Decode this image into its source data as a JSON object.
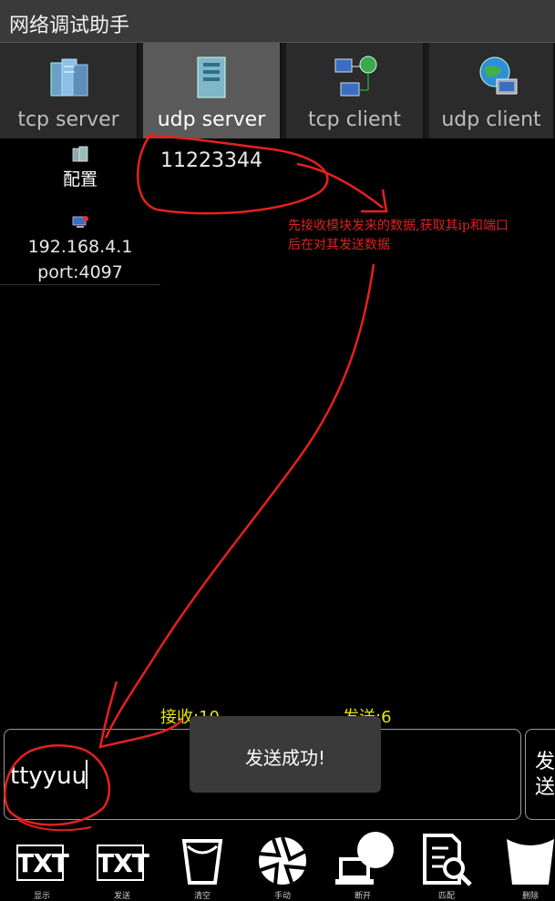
{
  "app": {
    "title": "网络调试助手"
  },
  "tabs": [
    {
      "label": "tcp server",
      "icon": "server-icon",
      "active": false
    },
    {
      "label": "udp server",
      "icon": "server-tower-icon",
      "active": true
    },
    {
      "label": "tcp client",
      "icon": "network-globe-icon",
      "active": false
    },
    {
      "label": "udp client",
      "icon": "globe-computer-icon",
      "active": false
    }
  ],
  "left_panel": {
    "config_label": "配置",
    "device_ip": "192.168.4.1",
    "device_port": "port:4097"
  },
  "received": {
    "text": "11223344"
  },
  "annotation": {
    "line1": "先接收模块发来的数据,获取其ip和端口",
    "line2": "后在对其发送数据"
  },
  "counters": {
    "recv": "接收:10",
    "send": "发送:6"
  },
  "input": {
    "value": "ttyyuu"
  },
  "send_button": {
    "label": "发送"
  },
  "toast": {
    "text": "发送成功!"
  },
  "toolbar": [
    {
      "icon": "txt-display-icon",
      "label": "显示"
    },
    {
      "icon": "txt-send-icon",
      "label": "发送"
    },
    {
      "icon": "clear-cup-icon",
      "label": "清空"
    },
    {
      "icon": "manual-aperture-icon",
      "label": "手动"
    },
    {
      "icon": "disconnect-icon",
      "label": "断开"
    },
    {
      "icon": "config-search-icon",
      "label": "匹配"
    },
    {
      "icon": "delete-cup-icon",
      "label": "删除"
    }
  ],
  "colors": {
    "annotation": "#e02020",
    "counter": "#e6e600",
    "active_tab": "#5a5a5a"
  }
}
